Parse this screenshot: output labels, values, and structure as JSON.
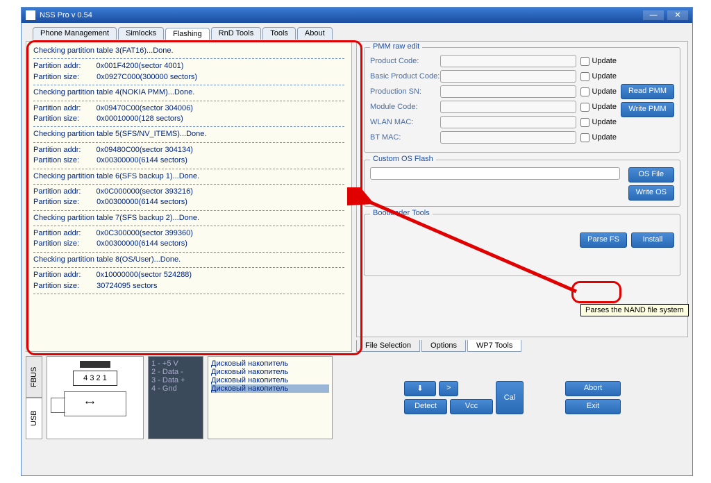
{
  "window": {
    "title": "NSS Pro v 0.54"
  },
  "tabs": {
    "phone_mgmt": "Phone Management",
    "simlocks": "Simlocks",
    "flashing": "Flashing",
    "rnd": "RnD Tools",
    "tools": "Tools",
    "about": "About"
  },
  "log": {
    "l1": "Checking partition table 3(FAT16)...Done.",
    "l2a": "Partition addr:",
    "l2b": "0x001F4200(sector 4001)",
    "l3a": "Partition size:",
    "l3b": "0x0927C000(300000 sectors)",
    "l4": "Checking partition table 4(NOKIA PMM)...Done.",
    "l5a": "Partition addr:",
    "l5b": "0x09470C00(sector 304006)",
    "l6a": "Partition size:",
    "l6b": "0x00010000(128 sectors)",
    "l7": "Checking partition table 5(SFS/NV_ITEMS)...Done.",
    "l8a": "Partition addr:",
    "l8b": "0x09480C00(sector 304134)",
    "l9a": "Partition size:",
    "l9b": "0x00300000(6144 sectors)",
    "l10": "Checking partition table 6(SFS backup 1)...Done.",
    "l11a": "Partition addr:",
    "l11b": "0x0C000000(sector 393216)",
    "l12a": "Partition size:",
    "l12b": "0x00300000(6144 sectors)",
    "l13": "Checking partition table 7(SFS backup 2)...Done.",
    "l14a": "Partition addr:",
    "l14b": "0x0C300000(sector 399360)",
    "l15a": "Partition size:",
    "l15b": "0x00300000(6144 sectors)",
    "l16": "Checking partition table 8(OS/User)...Done.",
    "l17a": "Partition addr:",
    "l17b": "0x10000000(sector 524288)",
    "l18a": "Partition size:",
    "l18b": "30724095 sectors"
  },
  "pmm": {
    "group": "PMM raw edit",
    "product_code": "Product Code:",
    "basic_product_code": "Basic Product Code:",
    "production_sn": "Production SN:",
    "module_code": "Module Code:",
    "wlan_mac": "WLAN MAC:",
    "bt_mac": "BT MAC:",
    "update": "Update",
    "read_pmm": "Read PMM",
    "write_pmm": "Write PMM"
  },
  "custom_os": {
    "group": "Custom OS Flash",
    "os_file": "OS File",
    "write_os": "Write OS"
  },
  "boot": {
    "group": "Bootloader Tools",
    "parse_fs": "Parse FS",
    "install": "Install",
    "tooltip": "Parses the NAND file system"
  },
  "bottabs": {
    "file_sel": "File Selection",
    "options": "Options",
    "wp7": "WP7 Tools"
  },
  "pins": {
    "p1": "1 - +5 V",
    "p2": "2 - Data -",
    "p3": "3 - Data +",
    "p4": "4 - Gnd"
  },
  "usb_labels": {
    "numbers": "4 3 2 1"
  },
  "drives": {
    "d1": "Дисковый накопитель",
    "d2": "Дисковый накопитель",
    "d3": "Дисковый накопитель",
    "d4": "Дисковый накопитель"
  },
  "ctrl": {
    "detect": "Detect",
    "vcc": "Vcc",
    "cal": "Cal",
    "abort": "Abort",
    "exit": "Exit"
  },
  "side": {
    "usb": "USB",
    "fbus": "FBUS"
  }
}
